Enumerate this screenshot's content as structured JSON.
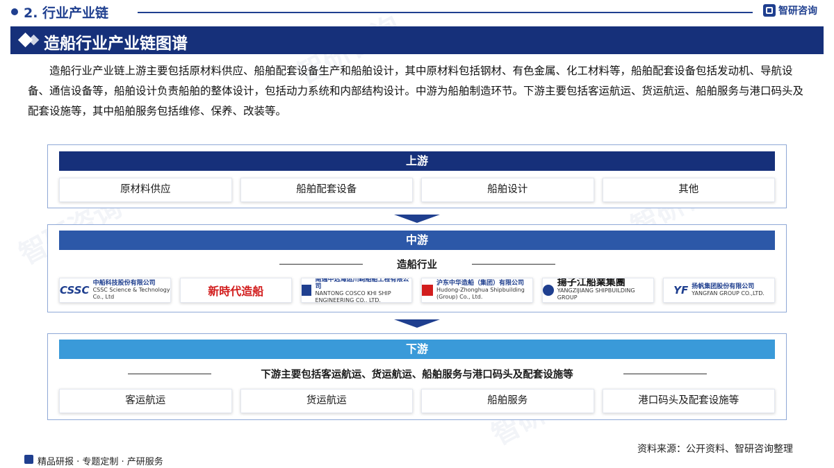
{
  "header": {
    "section": "2. 行业产业链",
    "brand": "智研咨询",
    "title": "造船行业产业链图谱"
  },
  "intro": "造船行业产业链上游主要包括原材料供应、船舶配套设备生产和船舶设计，其中原材料包括钢材、有色金属、化工材料等，船舶配套设备包括发动机、导航设备、通信设备等，船舶设计负责船舶的整体设计，包括动力系统和内部结构设计。中游为船舶制造环节。下游主要包括客运航运、货运航运、船舶服务与港口码头及配套设施等，其中船舶服务包括维修、保养、改装等。",
  "upstream": {
    "label": "上游",
    "items": [
      "原材料供应",
      "船舶配套设备",
      "船舶设计",
      "其他"
    ]
  },
  "midstream": {
    "label": "中游",
    "subtitle": "造船行业",
    "companies": [
      {
        "mark": "CSSC",
        "name": "中船科技股份有限公司",
        "en": "CSSC Science & Technology Co., Ltd"
      },
      {
        "mark": "新時代造船",
        "name": "",
        "en": ""
      },
      {
        "mark": "",
        "name": "南通中远海运川崎船舶工程有限公司",
        "en": "NANTONG COSCO KHI SHIP ENGINEERING CO., LTD."
      },
      {
        "mark": "",
        "name": "沪东中华造船（集团）有限公司",
        "en": "Hudong-Zhonghua Shipbuilding (Group) Co., Ltd."
      },
      {
        "mark": "揚子江船業集團",
        "name": "",
        "en": "YANGZIJIANG SHIPBUILDING GROUP"
      },
      {
        "mark": "YF",
        "name": "扬帆集团股份有限公司",
        "en": "YANGFAN GROUP CO.,LTD."
      }
    ]
  },
  "downstream": {
    "label": "下游",
    "subtitle": "下游主要包括客运航运、货运航运、船舶服务与港口码头及配套设施等",
    "items": [
      "客运航运",
      "货运航运",
      "船舶服务",
      "港口码头及配套设施等"
    ]
  },
  "footer": {
    "left": "精品研报 · 专题定制 · 产研服务",
    "source": "资料来源：公开资料、智研咨询整理"
  },
  "colors": {
    "navy": "#16307a",
    "mid_blue": "#2c58a8",
    "light_blue": "#3a9ad9"
  }
}
